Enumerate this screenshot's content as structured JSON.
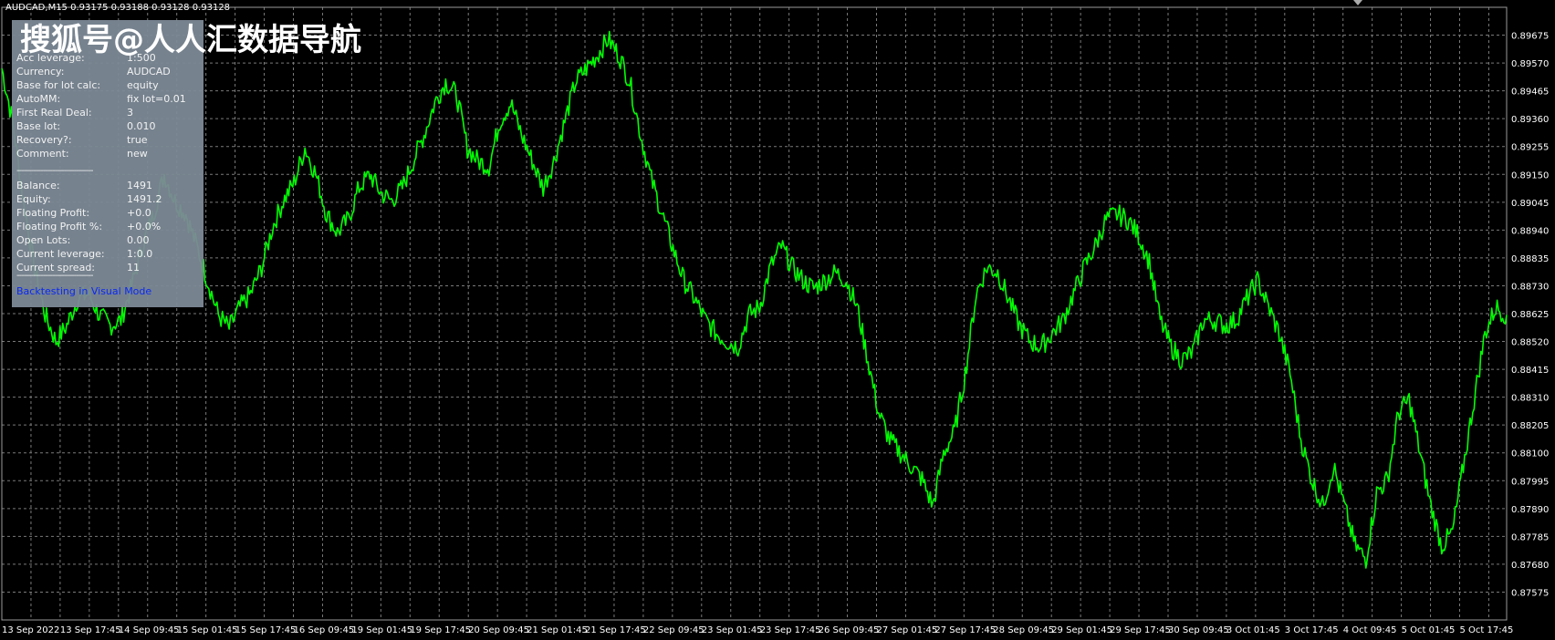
{
  "header": {
    "symbol_line": "AUDCAD,M15  0.93175 0.93188 0.93128 0.93128",
    "watermark": "搜狐号@人人汇数据导航"
  },
  "info_panel": {
    "rows_a": [
      {
        "key": "Acc leverage:",
        "value": "1:500"
      },
      {
        "key": "Currency:",
        "value": "AUDCAD"
      },
      {
        "key": "Base for lot calc:",
        "value": "equity"
      },
      {
        "key": "AutoMM:",
        "value": "fix lot=0.01"
      },
      {
        "key": "First Real Deal:",
        "value": "3"
      },
      {
        "key": "Base lot:",
        "value": "0.010"
      },
      {
        "key": "Recovery?:",
        "value": "true"
      },
      {
        "key": "Comment:",
        "value": "new"
      }
    ],
    "separator": "--------------------------------",
    "rows_b": [
      {
        "key": "Balance:",
        "value": "1491"
      },
      {
        "key": "Equity:",
        "value": "1491.2"
      },
      {
        "key": "Floating Profit:",
        "value": "+0.0"
      },
      {
        "key": "Floating Profit %:",
        "value": "+0.0%"
      },
      {
        "key": "Open Lots:",
        "value": "0.00"
      },
      {
        "key": "Current leverage:",
        "value": "1:0.0"
      },
      {
        "key": "Current spread:",
        "value": "11"
      }
    ],
    "link": "Backtesting in Visual Mode"
  },
  "colors": {
    "line": "#00ff00",
    "background": "#000000",
    "grid": "#7a7a7a",
    "panel": "#7d8a96",
    "link": "#0b2bff"
  },
  "chart_data": {
    "type": "line",
    "title": "",
    "xlabel": "",
    "ylabel": "",
    "grid": true,
    "ylim": [
      0.8747,
      0.8978
    ],
    "y_ticks": [
      "0.89675",
      "0.89570",
      "0.89465",
      "0.89360",
      "0.89255",
      "0.89150",
      "0.89045",
      "0.88940",
      "0.88835",
      "0.88730",
      "0.88625",
      "0.88520",
      "0.88415",
      "0.88310",
      "0.88205",
      "0.88100",
      "0.87995",
      "0.87890",
      "0.87785",
      "0.87680",
      "0.87575"
    ],
    "x_ticks": [
      "13 Sep 2022",
      "13 Sep 17:45",
      "14 Sep 09:45",
      "15 Sep 01:45",
      "15 Sep 17:45",
      "16 Sep 09:45",
      "19 Sep 01:45",
      "19 Sep 17:45",
      "20 Sep 09:45",
      "21 Sep 01:45",
      "21 Sep 17:45",
      "22 Sep 09:45",
      "23 Sep 01:45",
      "23 Sep 17:45",
      "26 Sep 09:45",
      "27 Sep 01:45",
      "27 Sep 17:45",
      "28 Sep 09:45",
      "29 Sep 01:45",
      "29 Sep 17:45",
      "30 Sep 09:45",
      "3 Oct 01:45",
      "3 Oct 17:45",
      "4 Oct 09:45",
      "5 Oct 01:45",
      "5 Oct 17:45"
    ],
    "series": [
      {
        "values": [
          0.8955,
          0.8935,
          0.8905,
          0.888,
          0.8862,
          0.8852,
          0.8858,
          0.8868,
          0.887,
          0.8862,
          0.8858,
          0.886,
          0.8873,
          0.8888,
          0.89,
          0.8915,
          0.8905,
          0.89,
          0.8888,
          0.8875,
          0.8862,
          0.8857,
          0.8865,
          0.887,
          0.888,
          0.8895,
          0.8905,
          0.8912,
          0.8925,
          0.8915,
          0.89,
          0.8893,
          0.8898,
          0.891,
          0.8915,
          0.8908,
          0.8905,
          0.891,
          0.892,
          0.893,
          0.8942,
          0.895,
          0.8945,
          0.8925,
          0.892,
          0.8918,
          0.8935,
          0.8942,
          0.893,
          0.892,
          0.891,
          0.892,
          0.8935,
          0.895,
          0.8955,
          0.896,
          0.8966,
          0.896,
          0.895,
          0.893,
          0.8913,
          0.89,
          0.8887,
          0.8875,
          0.8868,
          0.886,
          0.8855,
          0.8852,
          0.885,
          0.8862,
          0.8865,
          0.888,
          0.8888,
          0.888,
          0.8875,
          0.8872,
          0.8875,
          0.8878,
          0.8875,
          0.8865,
          0.8845,
          0.8825,
          0.8815,
          0.881,
          0.8805,
          0.88,
          0.879,
          0.881,
          0.8818,
          0.884,
          0.887,
          0.888,
          0.8878,
          0.8868,
          0.8858,
          0.8852,
          0.885,
          0.8855,
          0.886,
          0.887,
          0.888,
          0.8888,
          0.8898,
          0.89,
          0.8898,
          0.8892,
          0.8882,
          0.886,
          0.885,
          0.8845,
          0.8848,
          0.886,
          0.886,
          0.8858,
          0.886,
          0.8868,
          0.8875,
          0.8865,
          0.8855,
          0.884,
          0.8815,
          0.88,
          0.879,
          0.8805,
          0.879,
          0.8775,
          0.877,
          0.8795,
          0.88,
          0.8825,
          0.883,
          0.881,
          0.879,
          0.8775,
          0.878,
          0.8805,
          0.883,
          0.8855,
          0.8865,
          0.8862
        ]
      }
    ]
  }
}
